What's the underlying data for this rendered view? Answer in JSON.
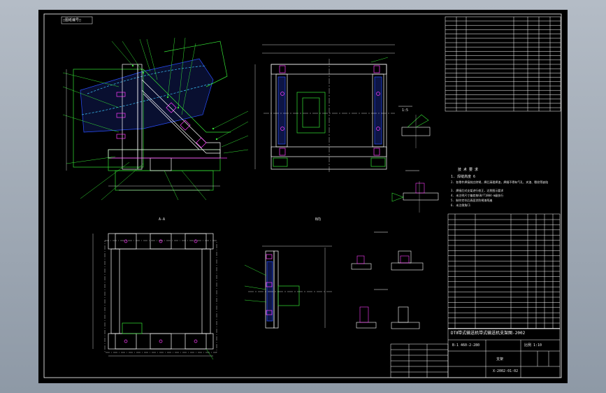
{
  "drawing": {
    "corner_tag": "□图纸编号□",
    "main_title": "DTⅡ带式输送机带式输送机支架图-2002",
    "sub_title": "支架",
    "drawing_number": "B-1 460-2-280",
    "scale": "比例 1:10",
    "sheet": "X-2002-01-02"
  },
  "views": {
    "view_a": "A-A",
    "view_b": "B向",
    "detail_ratio": "1:5"
  },
  "notes": {
    "heading": "技 术 要 求",
    "items": [
      "1. 焊缝高度 6",
      "2. 各零件焊接前应除锈，焊后清理焊渣，焊缝不得有气孔、夹渣、裂纹等缺陷",
      "3. 焊接后对支架进行校正，达到图示要求",
      "4. 未注明尺寸偏差按GB/T1804-m级执行",
      "5. 制作完毕后表面涂防锈漆两遍",
      "6. 未注倒角C1"
    ]
  },
  "colors": {
    "line": "#ffffff",
    "green": "#35e335",
    "magenta": "#ff3cff",
    "cyan": "#3cc8ff",
    "blue": "#2a4fff",
    "yellow": "#e6e633",
    "sheet_bg": "#000000"
  }
}
